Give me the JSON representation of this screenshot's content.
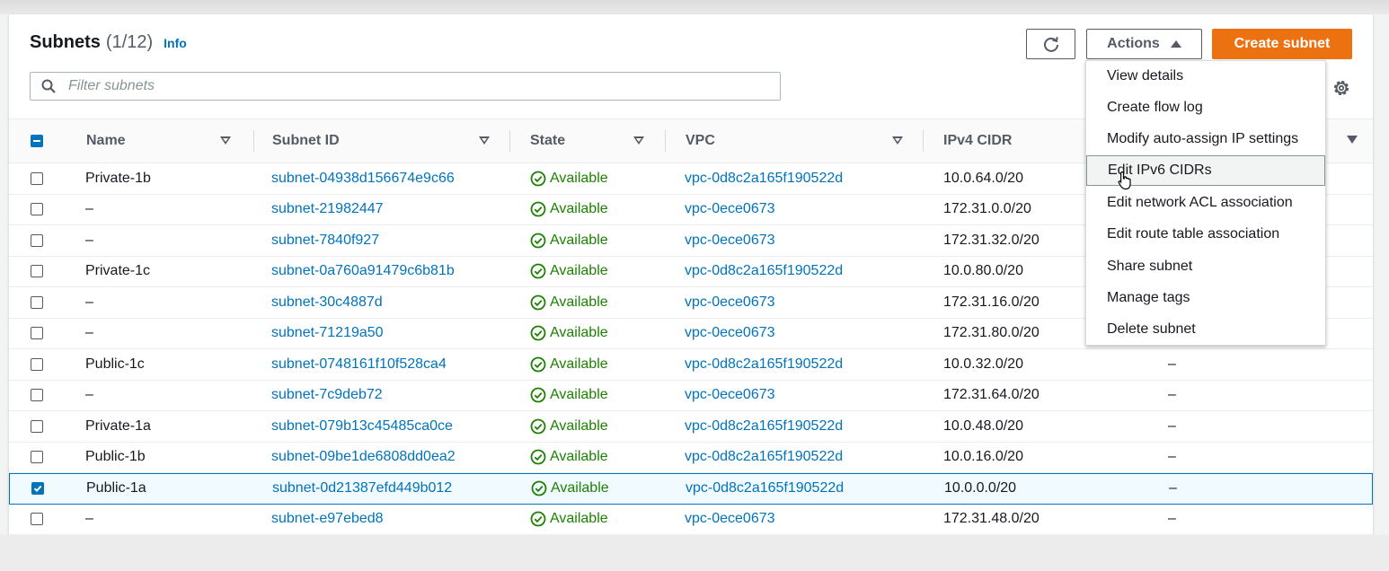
{
  "header": {
    "title": "Subnets",
    "count": "(1/12)",
    "info_label": "Info"
  },
  "toolbar": {
    "actions_label": "Actions",
    "create_label": "Create subnet"
  },
  "search": {
    "placeholder": "Filter subnets",
    "value": ""
  },
  "table": {
    "columns": [
      "Name",
      "Subnet ID",
      "State",
      "VPC",
      "IPv4 CIDR"
    ],
    "rows": [
      {
        "name": "Private-1b",
        "subnet_id": "subnet-04938d156674e9c66",
        "state": "Available",
        "vpc": "vpc-0d8c2a165f190522d",
        "ipv4": "10.0.64.0/20",
        "ipv6": "",
        "checked": false
      },
      {
        "name": "–",
        "subnet_id": "subnet-21982447",
        "state": "Available",
        "vpc": "vpc-0ece0673",
        "ipv4": "172.31.0.0/20",
        "ipv6": "",
        "checked": false
      },
      {
        "name": "–",
        "subnet_id": "subnet-7840f927",
        "state": "Available",
        "vpc": "vpc-0ece0673",
        "ipv4": "172.31.32.0/20",
        "ipv6": "",
        "checked": false
      },
      {
        "name": "Private-1c",
        "subnet_id": "subnet-0a760a91479c6b81b",
        "state": "Available",
        "vpc": "vpc-0d8c2a165f190522d",
        "ipv4": "10.0.80.0/20",
        "ipv6": "",
        "checked": false
      },
      {
        "name": "–",
        "subnet_id": "subnet-30c4887d",
        "state": "Available",
        "vpc": "vpc-0ece0673",
        "ipv4": "172.31.16.0/20",
        "ipv6": "",
        "checked": false
      },
      {
        "name": "–",
        "subnet_id": "subnet-71219a50",
        "state": "Available",
        "vpc": "vpc-0ece0673",
        "ipv4": "172.31.80.0/20",
        "ipv6": "",
        "checked": false
      },
      {
        "name": "Public-1c",
        "subnet_id": "subnet-0748161f10f528ca4",
        "state": "Available",
        "vpc": "vpc-0d8c2a165f190522d",
        "ipv4": "10.0.32.0/20",
        "ipv6": "–",
        "checked": false
      },
      {
        "name": "–",
        "subnet_id": "subnet-7c9deb72",
        "state": "Available",
        "vpc": "vpc-0ece0673",
        "ipv4": "172.31.64.0/20",
        "ipv6": "–",
        "checked": false
      },
      {
        "name": "Private-1a",
        "subnet_id": "subnet-079b13c45485ca0ce",
        "state": "Available",
        "vpc": "vpc-0d8c2a165f190522d",
        "ipv4": "10.0.48.0/20",
        "ipv6": "–",
        "checked": false
      },
      {
        "name": "Public-1b",
        "subnet_id": "subnet-09be1de6808dd0ea2",
        "state": "Available",
        "vpc": "vpc-0d8c2a165f190522d",
        "ipv4": "10.0.16.0/20",
        "ipv6": "–",
        "checked": false
      },
      {
        "name": "Public-1a",
        "subnet_id": "subnet-0d21387efd449b012",
        "state": "Available",
        "vpc": "vpc-0d8c2a165f190522d",
        "ipv4": "10.0.0.0/20",
        "ipv6": "–",
        "checked": true
      },
      {
        "name": "–",
        "subnet_id": "subnet-e97ebed8",
        "state": "Available",
        "vpc": "vpc-0ece0673",
        "ipv4": "172.31.48.0/20",
        "ipv6": "–",
        "checked": false
      }
    ]
  },
  "actions_menu": {
    "items": [
      "View details",
      "Create flow log",
      "Modify auto-assign IP settings",
      "Edit IPv6 CIDRs",
      "Edit network ACL association",
      "Edit route table association",
      "Share subnet",
      "Manage tags",
      "Delete subnet"
    ],
    "hovered": "Edit IPv6 CIDRs"
  },
  "icons": {
    "refresh": "refresh-icon",
    "actions_caret": "caret-up-icon",
    "search": "search-icon",
    "settings": "gear-icon",
    "status": "check-circle-icon",
    "filter": "filter-triangle-icon"
  },
  "colors": {
    "accent": "#0073bb",
    "create_button": "#ec7211",
    "available": "#1d8102"
  }
}
